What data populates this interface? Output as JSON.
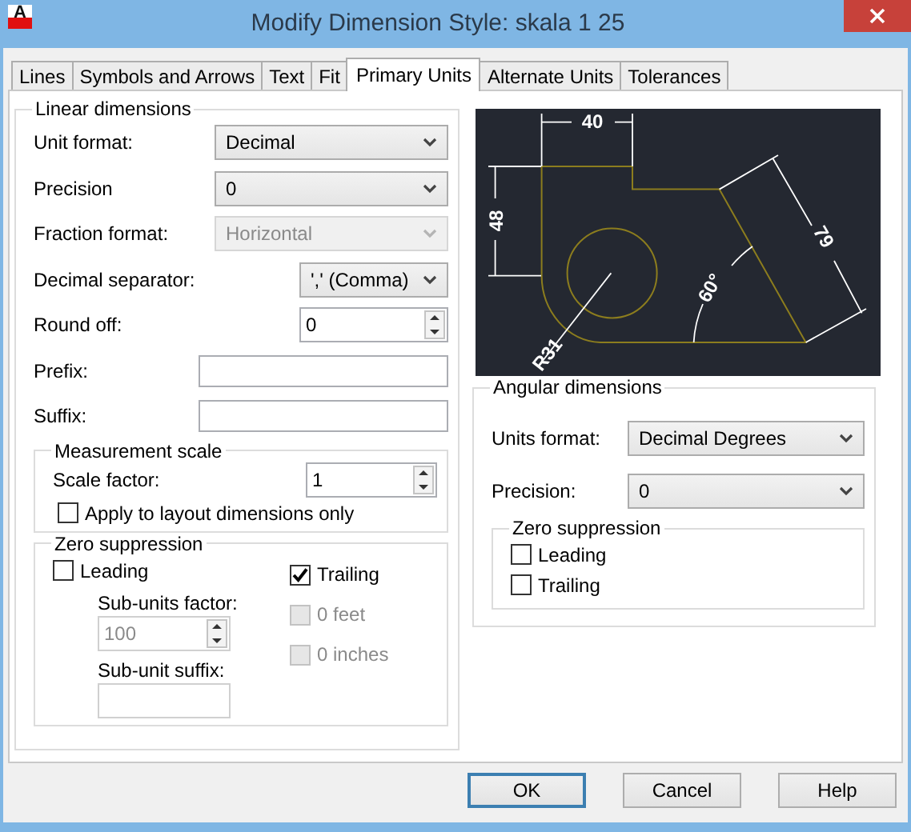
{
  "window": {
    "icon_text": "A",
    "title": "Modify Dimension Style: skala 1 25"
  },
  "tabs": [
    {
      "label": "Lines",
      "selected": false
    },
    {
      "label": "Symbols and Arrows",
      "selected": false
    },
    {
      "label": "Text",
      "selected": false
    },
    {
      "label": "Fit",
      "selected": false
    },
    {
      "label": "Primary Units",
      "selected": true
    },
    {
      "label": "Alternate Units",
      "selected": false
    },
    {
      "label": "Tolerances",
      "selected": false
    }
  ],
  "linear_dimensions": {
    "title": "Linear dimensions",
    "fields": [
      {
        "kind": "select",
        "label": "Unit format:",
        "value": "Decimal",
        "disabled": false
      },
      {
        "kind": "select",
        "label": "Precision",
        "value": "0",
        "disabled": false
      },
      {
        "kind": "select",
        "label": "Fraction format:",
        "value": "Horizontal",
        "disabled": true
      },
      {
        "kind": "select",
        "label": "Decimal separator:",
        "value": "',' (Comma)",
        "disabled": false
      },
      {
        "kind": "spin",
        "label": "Round off:",
        "value": "0",
        "disabled": false
      },
      {
        "kind": "text",
        "label": "Prefix:",
        "disabled": false
      },
      {
        "kind": "text",
        "label": "Suffix:",
        "disabled": false
      }
    ]
  },
  "measurement_scale": {
    "title": "Measurement scale",
    "scale_factor": {
      "label": "Scale factor:",
      "value": "1"
    },
    "apply_layout": {
      "label": "Apply to layout dimensions only",
      "checked": false
    }
  },
  "zero_suppression": {
    "title": "Zero suppression",
    "leading": {
      "label": "Leading",
      "checked": false
    },
    "sub_units_factor": {
      "label": "Sub-units factor:",
      "value": "100",
      "disabled": true
    },
    "sub_unit_suffix": {
      "label": "Sub-unit suffix:",
      "disabled": true
    },
    "trailing": {
      "label": "Trailing",
      "checked": true,
      "disabled": false
    },
    "feet": {
      "label": "0 feet",
      "checked": false,
      "disabled": true
    },
    "inches": {
      "label": "0 inches",
      "checked": false,
      "disabled": true
    }
  },
  "preview": {
    "labels": [
      "40",
      "48",
      "79",
      "60°",
      "R31"
    ]
  },
  "angular_dimensions": {
    "title": "Angular dimensions",
    "units_format": {
      "label": "Units format:",
      "value": "Decimal Degrees"
    },
    "precision": {
      "label": "Precision:",
      "value": "0"
    },
    "zero_suppression": {
      "title": "Zero suppression",
      "options": [
        {
          "label": "Leading",
          "checked": false
        },
        {
          "label": "Trailing",
          "checked": false
        }
      ]
    }
  },
  "buttons": [
    {
      "label": "OK",
      "default": true
    },
    {
      "label": "Cancel",
      "default": false
    },
    {
      "label": "Help",
      "default": false
    }
  ]
}
